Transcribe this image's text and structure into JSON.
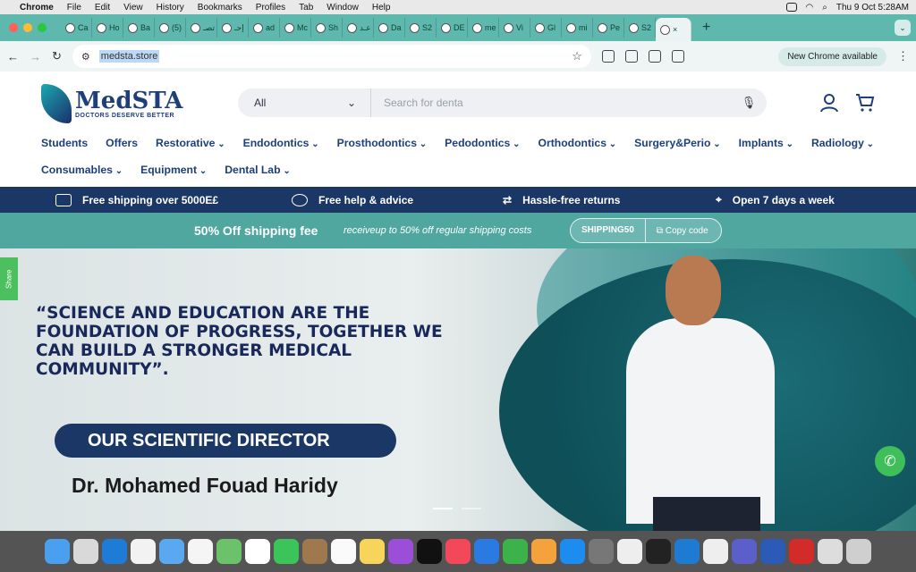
{
  "menubar": {
    "app": "Chrome",
    "items": [
      "File",
      "Edit",
      "View",
      "History",
      "Bookmarks",
      "Profiles",
      "Tab",
      "Window",
      "Help"
    ],
    "datetime": "Thu 9 Oct  5:28AM"
  },
  "tabs": [
    {
      "label": "Ca"
    },
    {
      "label": "Ho"
    },
    {
      "label": "Ba"
    },
    {
      "label": "(5)"
    },
    {
      "label": "تصـ"
    },
    {
      "label": "إحـ"
    },
    {
      "label": "ad"
    },
    {
      "label": "Mc"
    },
    {
      "label": "Sh"
    },
    {
      "label": "عـد"
    },
    {
      "label": "Da"
    },
    {
      "label": "S2"
    },
    {
      "label": "DE"
    },
    {
      "label": "me"
    },
    {
      "label": "Vi"
    },
    {
      "label": "Gl"
    },
    {
      "label": "mi"
    },
    {
      "label": "Pe"
    },
    {
      "label": "S2"
    },
    {
      "label": "×"
    }
  ],
  "toolbar": {
    "url": "medsta.store",
    "new_chrome": "New Chrome available"
  },
  "logo": {
    "name": "MedSTA",
    "tagline": "DOCTORS DESERVE BETTER"
  },
  "search": {
    "category": "All",
    "placeholder": "Search for denta"
  },
  "nav": [
    {
      "label": "Students",
      "dd": false
    },
    {
      "label": "Offers",
      "dd": false
    },
    {
      "label": "Restorative",
      "dd": true
    },
    {
      "label": "Endodontics",
      "dd": true
    },
    {
      "label": "Prosthodontics",
      "dd": true
    },
    {
      "label": "Pedodontics",
      "dd": true
    },
    {
      "label": "Orthodontics",
      "dd": true
    },
    {
      "label": "Surgery&Perio",
      "dd": true
    },
    {
      "label": "Implants",
      "dd": true
    },
    {
      "label": "Radiology",
      "dd": true
    },
    {
      "label": "Consumables",
      "dd": true
    },
    {
      "label": "Equipment",
      "dd": true
    },
    {
      "label": "Dental Lab",
      "dd": true
    }
  ],
  "ribbon": [
    "Free shipping over 5000E£",
    "Free help & advice",
    "Hassle-free returns",
    "Open 7 days a week"
  ],
  "promo": {
    "title": "50% Off shipping fee",
    "text": "receiveup to 50% off regular shipping costs",
    "code": "SHIPPING50",
    "copy": "Copy code"
  },
  "hero": {
    "quote": "“SCIENCE AND EDUCATION ARE THE FOUNDATION OF PROGRESS, TOGETHER WE CAN BUILD A STRONGER MEDICAL COMMUNITY”.",
    "pill": "OUR SCIENTIFIC DIRECTOR",
    "name": "Dr. Mohamed Fouad Haridy"
  },
  "share": "Share"
}
